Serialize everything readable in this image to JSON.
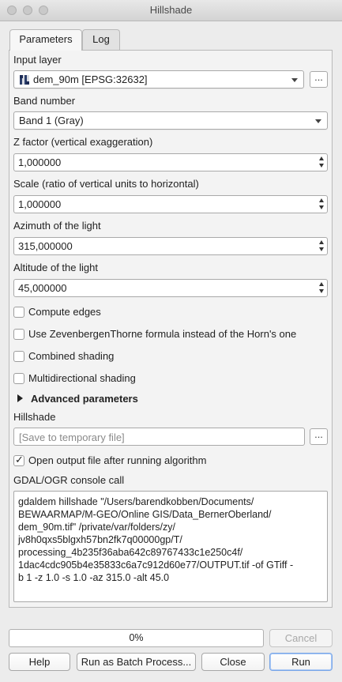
{
  "window": {
    "title": "Hillshade"
  },
  "tabs": [
    {
      "label": "Parameters",
      "active": true
    },
    {
      "label": "Log",
      "active": false
    }
  ],
  "params": {
    "input_layer": {
      "label": "Input layer",
      "value": "dem_90m [EPSG:32632]",
      "icon": "raster-layer-icon",
      "browse_label": "..."
    },
    "band": {
      "label": "Band number",
      "value": "Band 1 (Gray)"
    },
    "z_factor": {
      "label": "Z factor (vertical exaggeration)",
      "value": "1,000000"
    },
    "scale": {
      "label": "Scale (ratio of vertical units to horizontal)",
      "value": "1,000000"
    },
    "azimuth": {
      "label": "Azimuth of the light",
      "value": "315,000000"
    },
    "altitude": {
      "label": "Altitude of the light",
      "value": "45,000000"
    },
    "checks": [
      {
        "label": "Compute edges",
        "checked": false
      },
      {
        "label": "Use ZevenbergenThorne formula instead of the Horn's one",
        "checked": false
      },
      {
        "label": "Combined shading",
        "checked": false
      },
      {
        "label": "Multidirectional shading",
        "checked": false
      }
    ],
    "advanced": {
      "label": "Advanced parameters"
    },
    "output": {
      "label": "Hillshade",
      "placeholder": "[Save to temporary file]",
      "browse_label": "..."
    },
    "open_output": {
      "label": "Open output file after running algorithm",
      "checked": true
    },
    "console": {
      "label": "GDAL/OGR console call",
      "text": "gdaldem hillshade \"/Users/barendkobben/Documents/\nBEWAARMAP/M-GEO/Online GIS/Data_BernerOberland/\ndem_90m.tif\" /private/var/folders/zy/\njv8h0qxs5blgxh57bn2fk7q00000gp/T/\nprocessing_4b235f36aba642c89767433c1e250c4f/\n1dac4cdc905b4e35833c6a7c912d60e77/OUTPUT.tif -of GTiff -\nb 1 -z 1.0 -s 1.0 -az 315.0 -alt 45.0"
    }
  },
  "progress": {
    "percent_label": "0%",
    "value": 0
  },
  "buttons": {
    "cancel": "Cancel",
    "help": "Help",
    "batch": "Run as Batch Process...",
    "close": "Close",
    "run": "Run"
  }
}
